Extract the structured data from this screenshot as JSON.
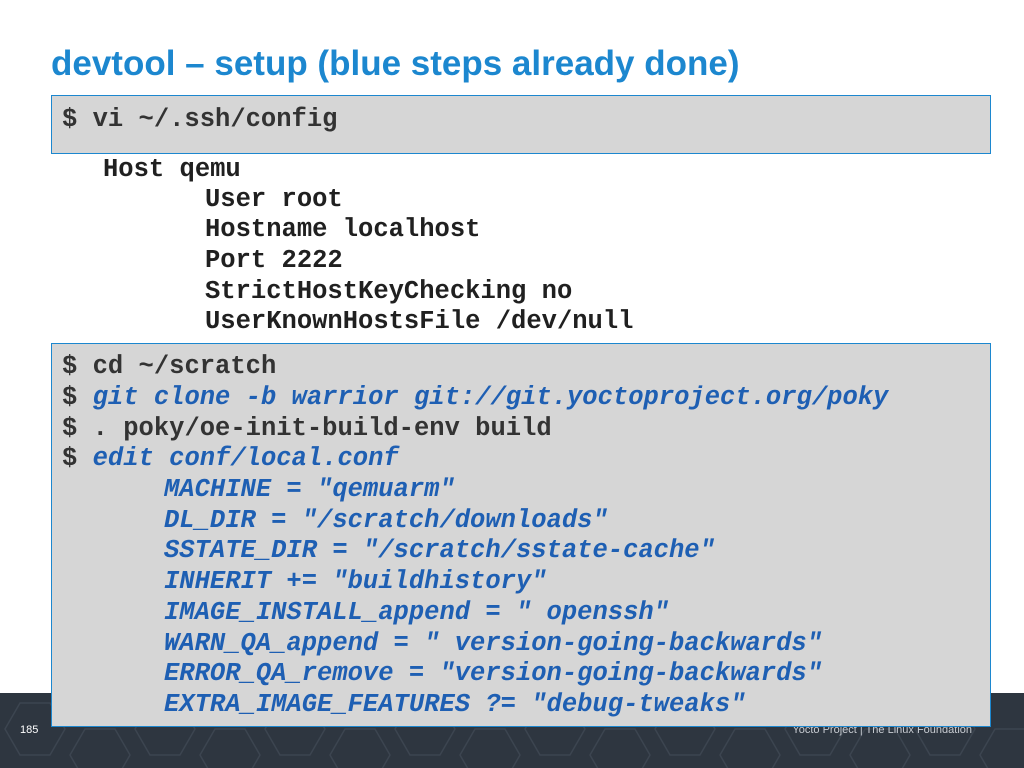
{
  "slide": {
    "title": "devtool – setup (blue steps already done)",
    "page_number": "185",
    "footer_text": "Yocto Project | The Linux Foundation",
    "colors": {
      "title": "#1c87cf",
      "box_border": "#1c87cf",
      "box_fill": "#d6d6d6",
      "highlight_text": "#1e5fb3",
      "footer_bg": "#2e3640"
    }
  },
  "box1": {
    "lines": [
      "$ vi ~/.ssh/config"
    ]
  },
  "ssh_config": {
    "host": "Host qemu",
    "user": "User root",
    "hostname": "Hostname localhost",
    "port": "Port 2222",
    "strict": "StrictHostKeyChecking no",
    "known_hosts": "UserKnownHostsFile /dev/null"
  },
  "box2": {
    "prompt": "$",
    "cd": "cd ~/scratch",
    "git_clone": "git clone -b warrior git://git.yoctoproject.org/poky",
    "init_env": ". poky/oe-init-build-env build",
    "edit": "edit conf/local.conf",
    "machine": "MACHINE = \"qemuarm\"",
    "dl_dir": "DL_DIR = \"/scratch/downloads\"",
    "sstate_dir": "SSTATE_DIR = \"/scratch/sstate-cache\"",
    "inherit": "INHERIT += \"buildhistory\"",
    "image_install": "IMAGE_INSTALL_append = \" openssh\"",
    "warn_qa": "WARN_QA_append = \" version-going-backwards\"",
    "error_qa": "ERROR_QA_remove = \"version-going-backwards\"",
    "extra_features": "EXTRA_IMAGE_FEATURES ?= \"debug-tweaks\""
  }
}
